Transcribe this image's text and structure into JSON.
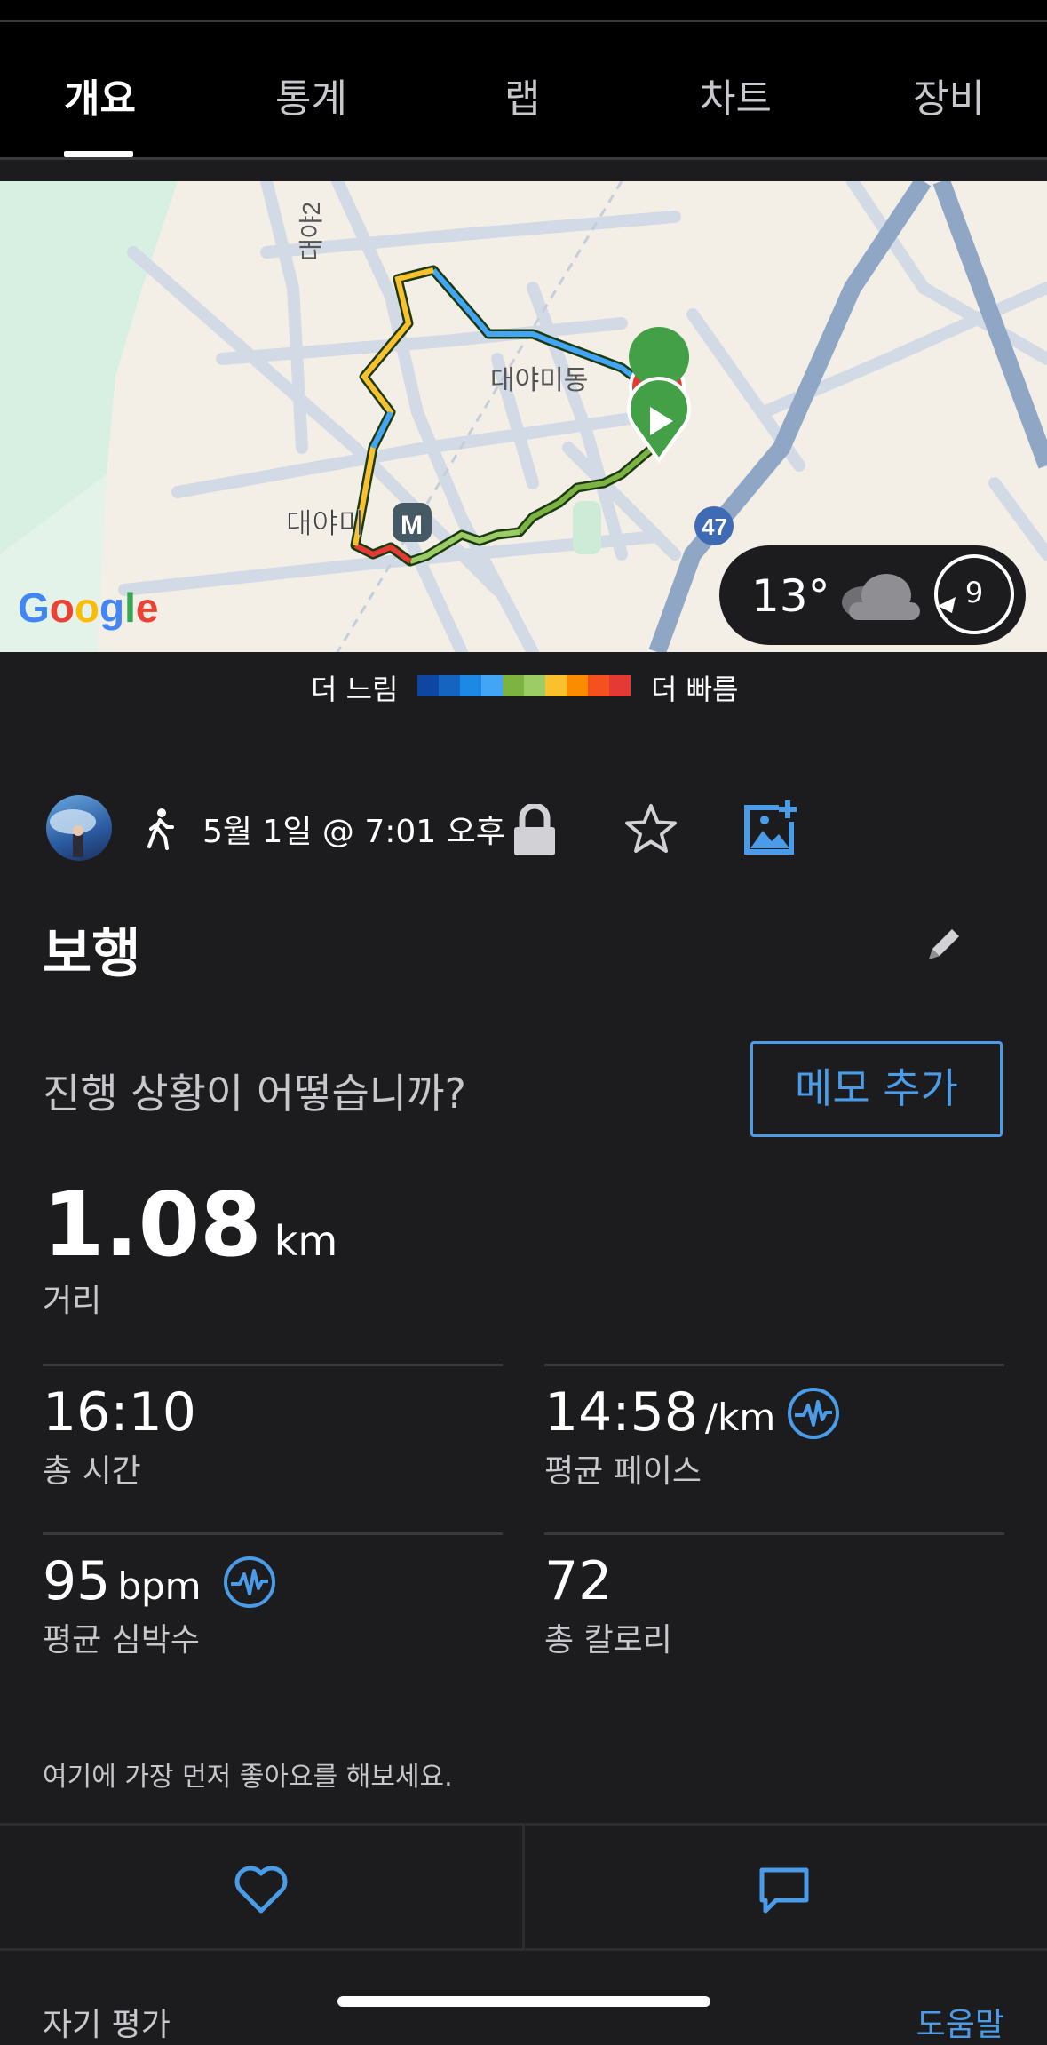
{
  "tabs": [
    {
      "label": "개요",
      "active": true
    },
    {
      "label": "통계",
      "active": false
    },
    {
      "label": "랩",
      "active": false
    },
    {
      "label": "차트",
      "active": false
    },
    {
      "label": "장비",
      "active": false
    }
  ],
  "map": {
    "labels": {
      "road": "대야2",
      "dong": "대야미동",
      "station": "대야미",
      "station_icon": "M",
      "route_badge": "47",
      "google": "Google"
    },
    "weather": {
      "temp": "13°",
      "wind": "9",
      "condition_icon": "cloud-icon"
    }
  },
  "legend": {
    "slow": "더 느림",
    "fast": "더 빠름",
    "colors": [
      "#0d47a1",
      "#1565c0",
      "#1e88e5",
      "#42a5f5",
      "#7cb342",
      "#9ccc65",
      "#fbc02d",
      "#fb8c00",
      "#f4511e",
      "#e53935"
    ]
  },
  "activity": {
    "date": "5월 1일 @ 7:01 오후",
    "title": "보행",
    "prompt": "진행 상황이 어떻습니까?",
    "memo_button": "메모 추가"
  },
  "distance": {
    "value": "1.08",
    "unit": "km",
    "label": "거리"
  },
  "stats": [
    {
      "value": "16:10",
      "unit": "",
      "label": "총 시간"
    },
    {
      "value": "14:58",
      "unit": "/km",
      "label": "평균 페이스"
    },
    {
      "value": "95",
      "unit": "bpm",
      "label": "평균 심박수"
    },
    {
      "value": "72",
      "unit": "",
      "label": "총 칼로리"
    }
  ],
  "likes_text": "여기에 가장 먼저 좋아요를 해보세요.",
  "footer": {
    "self_eval": "자기 평가",
    "help": "도움말"
  },
  "colors": {
    "accent": "#4a9be8",
    "background": "#1c1c1e"
  }
}
